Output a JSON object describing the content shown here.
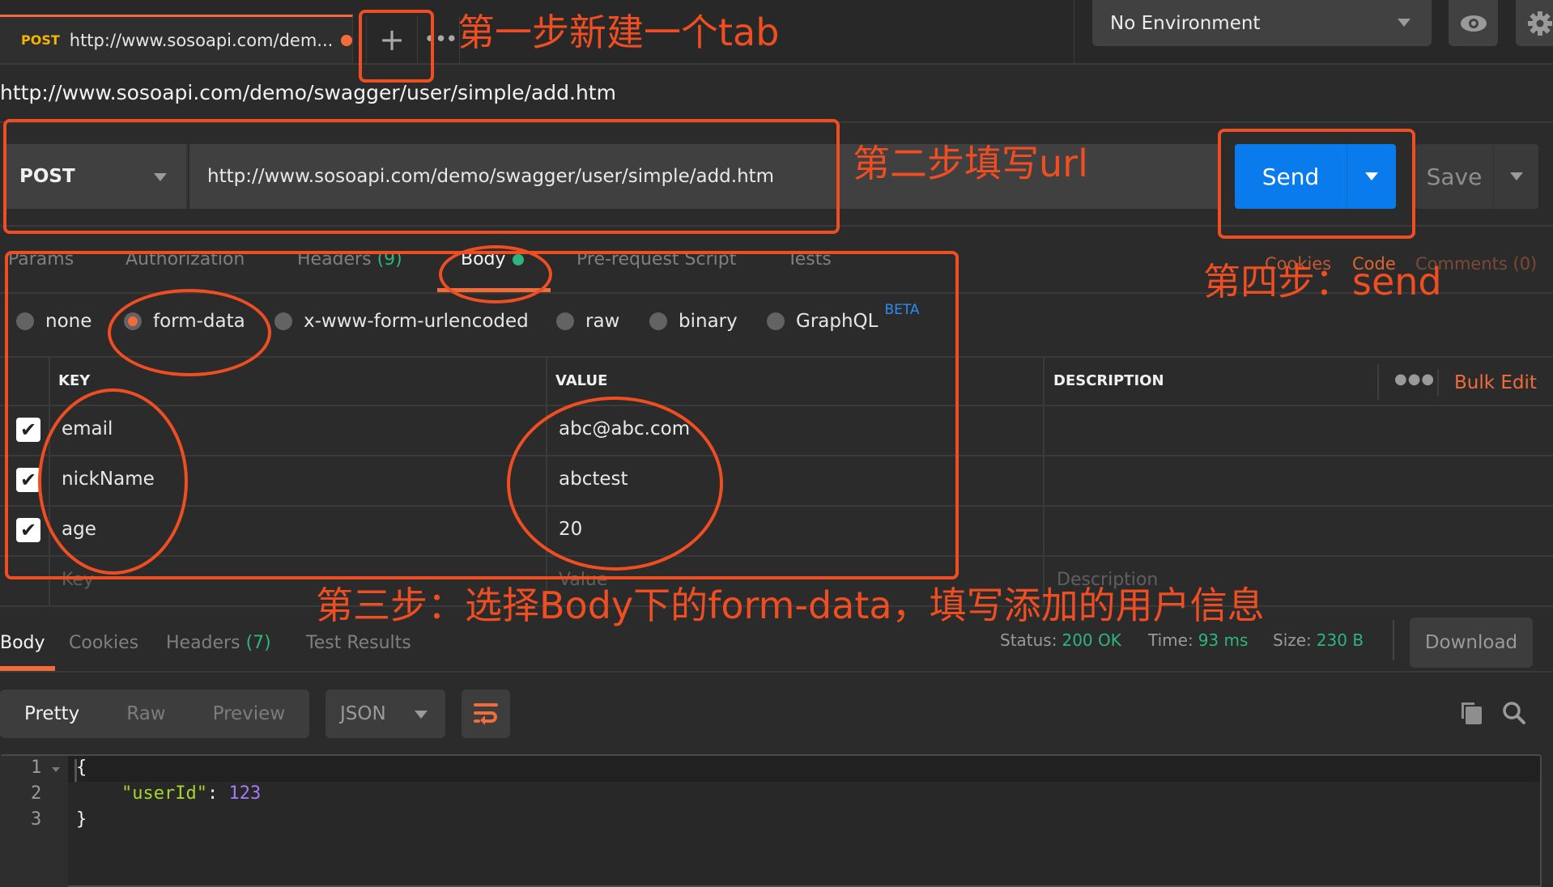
{
  "tabbar": {
    "tab": {
      "method": "POST",
      "url": "http://www.sosoapi.com/dem...",
      "unsaved_dot": true
    },
    "new_tab_icon": "plus-icon",
    "more_icon": "ellipsis-icon",
    "environment": "No Environment",
    "eye_icon": "eye-icon",
    "settings_icon": "gear-icon"
  },
  "request": {
    "title": "http://www.sosoapi.com/demo/swagger/user/simple/add.htm",
    "method": "POST",
    "url": "http://www.sosoapi.com/demo/swagger/user/simple/add.htm",
    "send_label": "Send",
    "save_label": "Save"
  },
  "request_tabs": {
    "params": "Params",
    "authorization": "Authorization",
    "headers": "Headers",
    "headers_count": "(9)",
    "body": "Body",
    "prerequest": "Pre-request Script",
    "tests": "Tests",
    "cookies": "Cookies",
    "code": "Code",
    "comments": "Comments (0)",
    "active": "Body"
  },
  "body_modes": {
    "options": [
      "none",
      "form-data",
      "x-www-form-urlencoded",
      "raw",
      "binary",
      "GraphQL"
    ],
    "selected": "form-data",
    "graphql_badge": "BETA"
  },
  "form_table": {
    "headers": {
      "key": "KEY",
      "value": "VALUE",
      "description": "DESCRIPTION"
    },
    "bulk_edit": "Bulk Edit",
    "rows": [
      {
        "checked": true,
        "key": "email",
        "value": "abc@abc.com",
        "description": ""
      },
      {
        "checked": true,
        "key": "nickName",
        "value": "abctest",
        "description": ""
      },
      {
        "checked": true,
        "key": "age",
        "value": "20",
        "description": ""
      }
    ],
    "placeholders": {
      "key": "Key",
      "value": "Value",
      "description": "Description"
    }
  },
  "response": {
    "tabs": {
      "body": "Body",
      "cookies": "Cookies",
      "headers": "Headers",
      "headers_count": "(7)",
      "test_results": "Test Results"
    },
    "status_label": "Status:",
    "status_value": "200 OK",
    "time_label": "Time:",
    "time_value": "93 ms",
    "size_label": "Size:",
    "size_value": "230 B",
    "download": "Download",
    "formats": {
      "pretty": "Pretty",
      "raw": "Raw",
      "preview": "Preview"
    },
    "language": "JSON",
    "code_lines": [
      {
        "num": "1",
        "text": "{"
      },
      {
        "num": "2",
        "key": "\"userId\"",
        "sep": ": ",
        "value": "123"
      },
      {
        "num": "3",
        "text": "}"
      }
    ]
  },
  "annotations": {
    "step1": "第一步新建一个tab",
    "step2": "第二步填写url",
    "step3": "第三步：选择Body下的form-data，填写添加的用户信息",
    "step4": "第四步：send",
    "color": "#ee4e22"
  },
  "colors": {
    "accent": "#f26b3a",
    "send_blue": "#097bed",
    "success_green": "#2cb67d"
  }
}
